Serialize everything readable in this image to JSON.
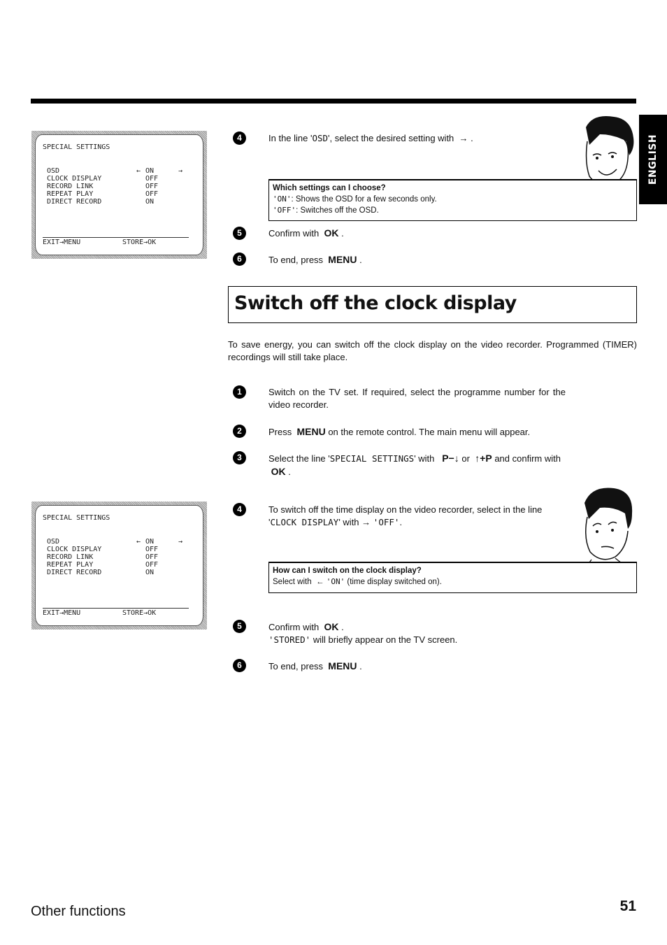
{
  "header": {
    "language_tab": "ENGLISH"
  },
  "osd_screens": [
    {
      "title": "SPECIAL SETTINGS",
      "rows": [
        {
          "label": "OSD",
          "value": "ON",
          "left_arrow": "←",
          "right_arrow": "→"
        },
        {
          "label": "CLOCK DISPLAY",
          "value": "OFF"
        },
        {
          "label": "RECORD LINK",
          "value": "OFF"
        },
        {
          "label": "REPEAT PLAY",
          "value": "OFF"
        },
        {
          "label": "DIRECT RECORD",
          "value": "ON"
        }
      ],
      "footer_left": "EXIT→MENU",
      "footer_right": "STORE→OK"
    },
    {
      "title": "SPECIAL SETTINGS",
      "rows": [
        {
          "label": "OSD",
          "value": "ON",
          "left_arrow": "←",
          "right_arrow": "→"
        },
        {
          "label": "CLOCK DISPLAY",
          "value": "OFF"
        },
        {
          "label": "RECORD LINK",
          "value": "OFF"
        },
        {
          "label": "REPEAT PLAY",
          "value": "OFF"
        },
        {
          "label": "DIRECT RECORD",
          "value": "ON"
        }
      ],
      "footer_left": "EXIT→MENU",
      "footer_right": "STORE→OK"
    }
  ],
  "top_section": {
    "step4": {
      "num": "4",
      "pre": "In the line '",
      "code": "OSD",
      "post": "', select the desired setting with",
      "arrow": "→",
      "end": "."
    },
    "hint": {
      "title": "Which settings can I choose?",
      "line1_code": "'ON'",
      "line1_text": ": Shows the OSD for a few seconds only.",
      "line2_code": "'OFF'",
      "line2_text": ": Switches off the OSD."
    },
    "step5": {
      "num": "5",
      "text": "Confirm with",
      "key": "OK",
      "end": "."
    },
    "step6": {
      "num": "6",
      "text": "To end, press",
      "key": "MENU",
      "end": "."
    }
  },
  "section": {
    "title": "Switch off the clock display",
    "intro": "To save energy, you can switch off the clock display on the video recorder. Programmed (TIMER) recordings will still take place.",
    "step1": {
      "num": "1",
      "text": "Switch on the TV set. If required, select the programme number for the video recorder."
    },
    "step2": {
      "num": "2",
      "pre": "Press",
      "key": "MENU",
      "post": "on the remote control. The main menu will appear."
    },
    "step3": {
      "num": "3",
      "pre": "Select the line '",
      "code": "SPECIAL SETTINGS",
      "mid": "' with",
      "key1": "P−↓",
      "or": "or",
      "key2": "↑+P",
      "post": "and confirm with",
      "key3": "OK",
      "end": "."
    },
    "step4": {
      "num": "4",
      "pre": "To switch off the time display on the video recorder, select in the line '",
      "code": "CLOCK DISPLAY",
      "mid": "' with",
      "arrow": "→",
      "code2": "'OFF'",
      "end": "."
    },
    "hint": {
      "title": "How can I switch on the clock display?",
      "pre": "Select with",
      "arrow": "←",
      "code": "'ON'",
      "post": "(time display switched on)."
    },
    "step5": {
      "num": "5",
      "text": "Confirm with",
      "key": "OK",
      "end": ".",
      "line2_code": "'STORED'",
      "line2_text": "will briefly appear on the TV screen."
    },
    "step6": {
      "num": "6",
      "text": "To end, press",
      "key": "MENU",
      "end": "."
    }
  },
  "footer": {
    "chapter": "Other functions",
    "page_number": "51"
  }
}
